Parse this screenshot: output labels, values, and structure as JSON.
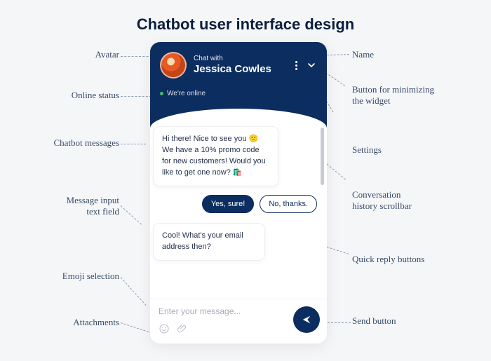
{
  "title": "Chatbot user interface design",
  "header": {
    "pre": "Chat with",
    "name": "Jessica Cowles",
    "online": "We're online"
  },
  "messages": {
    "m1": "Hi there! Nice to see you 🙂 We have a 10% promo code for new customers! Would you like to get one now? 🛍️",
    "m2": "Cool! What's your email address then?"
  },
  "replies": {
    "yes": "Yes, sure!",
    "no": "No, thanks."
  },
  "composer": {
    "placeholder": "Enter your message..."
  },
  "annotations": {
    "avatar": "Avatar",
    "online": "Online status",
    "messages": "Chatbot messages",
    "input": "Message input\ntext field",
    "emoji": "Emoji selection",
    "attach": "Attachments",
    "name": "Name",
    "minimize": "Button for minimizing\nthe widget",
    "settings": "Settings",
    "scrollbar": "Conversation\nhistory scrollbar",
    "quick": "Quick reply buttons",
    "send": "Send button"
  }
}
